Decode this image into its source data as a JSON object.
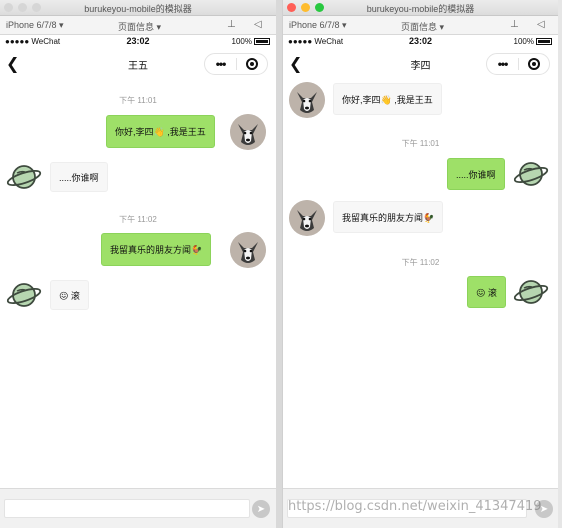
{
  "colors": {
    "self_bubble": "#9ee068",
    "other_bubble": "#f7f7f7",
    "timestamp": "#999999",
    "planet_avatar": "#b6d6b0"
  },
  "window_title": "burukeyou-mobile的模拟器",
  "device_label": "iPhone 6/7/8 ▾",
  "pageinfo_label": "页面信息 ▾",
  "icons": {
    "pin": "pin-icon",
    "volume": "speaker-icon"
  },
  "status": {
    "carrier": "●●●●● WeChat",
    "time": "23:02",
    "battery": "100%"
  },
  "left": {
    "nav_title": "王五",
    "ts1": "下午 11:01",
    "msg1": "你好,李四👋 ,我是王五",
    "msg2": ".....你谁啊",
    "ts2": "下午 11:02",
    "msg3": "我留真乐的朋友方闻🐓",
    "msg4": "😖 滚"
  },
  "right": {
    "nav_title": "李四",
    "msg1": "你好,李四👋 ,我是王五",
    "ts1": "下午 11:01",
    "msg2": ".....你谁啊",
    "msg3": "我留真乐的朋友方闻🐓",
    "ts2": "下午 11:02",
    "msg4": "😖 滚"
  },
  "watermark": "https://blog.csdn.net/weixin_41347419"
}
